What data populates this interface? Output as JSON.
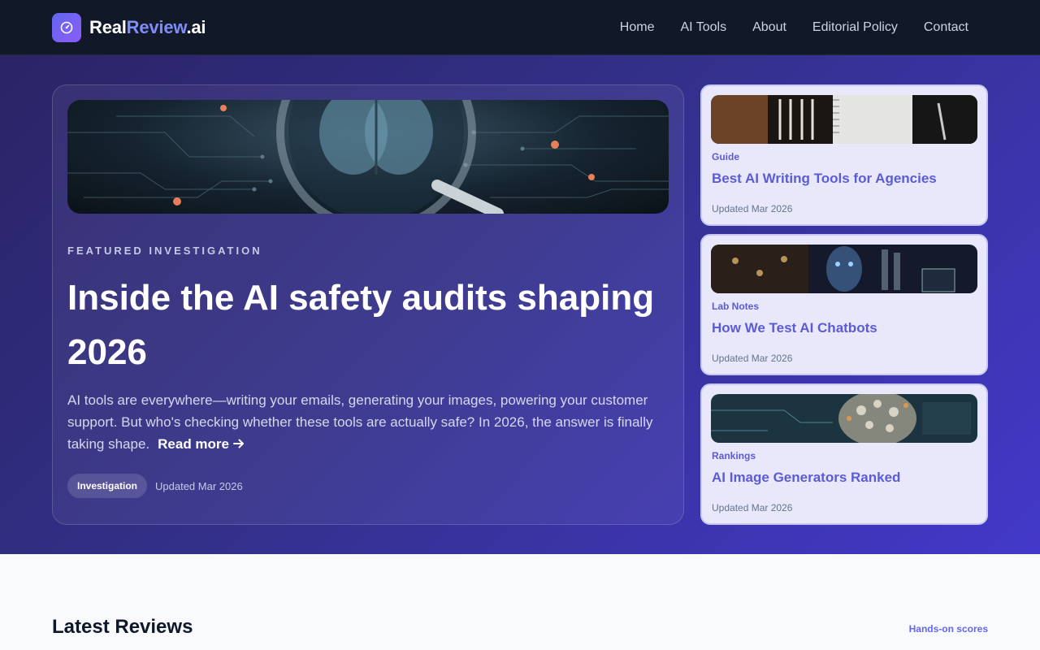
{
  "brand": {
    "name_part1": "Real",
    "name_part2": "Review",
    "name_part3": ".ai"
  },
  "nav": {
    "items": [
      "Home",
      "AI Tools",
      "About",
      "Editorial Policy",
      "Contact"
    ]
  },
  "featured": {
    "eyebrow": "FEATURED INVESTIGATION",
    "title": "Inside the AI safety audits shaping 2026",
    "excerpt": "AI tools are everywhere—writing your emails, generating your images, powering your customer support. But who's checking whether these tools are actually safe? In 2026, the answer is finally taking shape.",
    "read_more": "Read more",
    "tag": "Investigation",
    "updated": "Updated Mar 2026"
  },
  "side_cards": [
    {
      "category": "Guide",
      "title": "Best AI Writing Tools for Agencies",
      "updated": "Updated Mar 2026"
    },
    {
      "category": "Lab Notes",
      "title": "How We Test AI Chatbots",
      "updated": "Updated Mar 2026"
    },
    {
      "category": "Rankings",
      "title": "AI Image Generators Ranked",
      "updated": "Updated Mar 2026"
    }
  ],
  "latest": {
    "title": "Latest Reviews",
    "link": "Hands-on scores"
  },
  "icons": {
    "logo": "gauge-icon",
    "arrow": "arrow-right-icon"
  },
  "colors": {
    "nav_bg": "#111827",
    "accent": "#6366f1",
    "hero_start": "#2a2466",
    "hero_end": "#4338ca"
  }
}
